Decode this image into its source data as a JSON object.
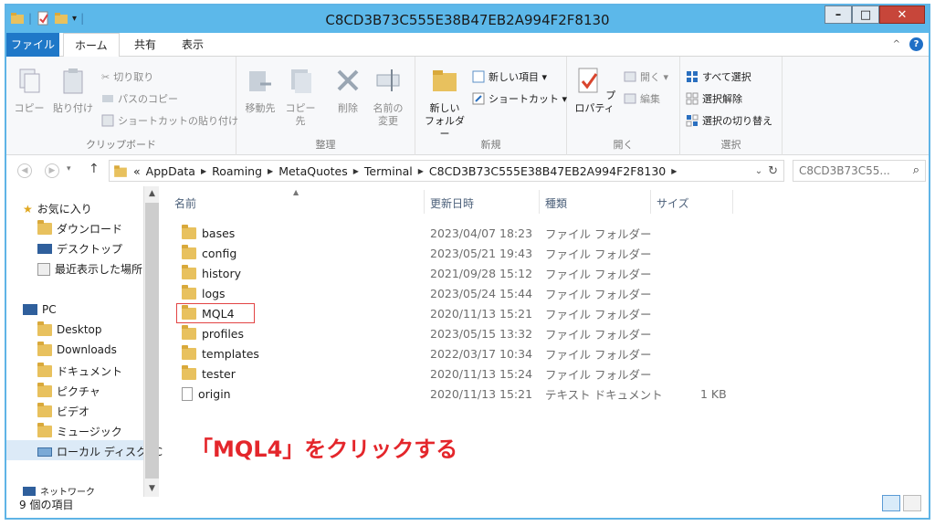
{
  "window": {
    "title": "C8CD3B73C555E38B47EB2A994F2F8130"
  },
  "tabs": {
    "file": "ファイル",
    "home": "ホーム",
    "share": "共有",
    "view": "表示"
  },
  "ribbon": {
    "clipboard": {
      "copy": "コピー",
      "paste": "貼り付け",
      "cut": "切り取り",
      "copy_path": "パスのコピー",
      "paste_shortcut": "ショートカットの貼り付け",
      "label": "クリップボード"
    },
    "organize": {
      "move_to": "移動先",
      "copy_to": "コピー先",
      "delete": "削除",
      "rename_line1": "名前の",
      "rename_line2": "変更",
      "label": "整理"
    },
    "new": {
      "new_folder_line1": "新しい",
      "new_folder_line2": "フォルダー",
      "new_item": "新しい項目 ▾",
      "shortcut": "ショートカット ▾",
      "label": "新規"
    },
    "open": {
      "properties": "プロパティ",
      "open": "開く ▾",
      "edit": "編集",
      "label": "開く"
    },
    "select": {
      "select_all": "すべて選択",
      "select_none": "選択解除",
      "invert": "選択の切り替え",
      "label": "選択"
    }
  },
  "address": {
    "prefix": "«",
    "crumbs": [
      "AppData",
      "Roaming",
      "MetaQuotes",
      "Terminal",
      "C8CD3B73C555E38B47EB2A994F2F8130"
    ],
    "search_placeholder": "C8CD3B73C55..."
  },
  "nav": {
    "favorites": "お気に入り",
    "downloads_jp": "ダウンロード",
    "desktop_jp": "デスクトップ",
    "recent": "最近表示した場所",
    "pc": "PC",
    "desktop": "Desktop",
    "downloads": "Downloads",
    "documents": "ドキュメント",
    "pictures": "ピクチャ",
    "videos": "ビデオ",
    "music": "ミュージック",
    "local_disk": "ローカル ディスク (C",
    "network": "ネットワーク"
  },
  "columns": {
    "name": "名前",
    "date": "更新日時",
    "type": "種類",
    "size": "サイズ"
  },
  "files": [
    {
      "name": "bases",
      "date": "2023/04/07 18:23",
      "type": "ファイル フォルダー",
      "size": ""
    },
    {
      "name": "config",
      "date": "2023/05/21 19:43",
      "type": "ファイル フォルダー",
      "size": ""
    },
    {
      "name": "history",
      "date": "2021/09/28 15:12",
      "type": "ファイル フォルダー",
      "size": ""
    },
    {
      "name": "logs",
      "date": "2023/05/24 15:44",
      "type": "ファイル フォルダー",
      "size": ""
    },
    {
      "name": "MQL4",
      "date": "2020/11/13 15:21",
      "type": "ファイル フォルダー",
      "size": ""
    },
    {
      "name": "profiles",
      "date": "2023/05/15 13:32",
      "type": "ファイル フォルダー",
      "size": ""
    },
    {
      "name": "templates",
      "date": "2022/03/17 10:34",
      "type": "ファイル フォルダー",
      "size": ""
    },
    {
      "name": "tester",
      "date": "2020/11/13 15:24",
      "type": "ファイル フォルダー",
      "size": ""
    },
    {
      "name": "origin",
      "date": "2020/11/13 15:21",
      "type": "テキスト ドキュメント",
      "size": "1 KB"
    }
  ],
  "annotation": "「MQL4」をクリックする",
  "status": "9 個の項目",
  "colors": {
    "titlebar": "#5cb8ea",
    "file_tab": "#1f78c8",
    "annotation": "#e4262b"
  }
}
